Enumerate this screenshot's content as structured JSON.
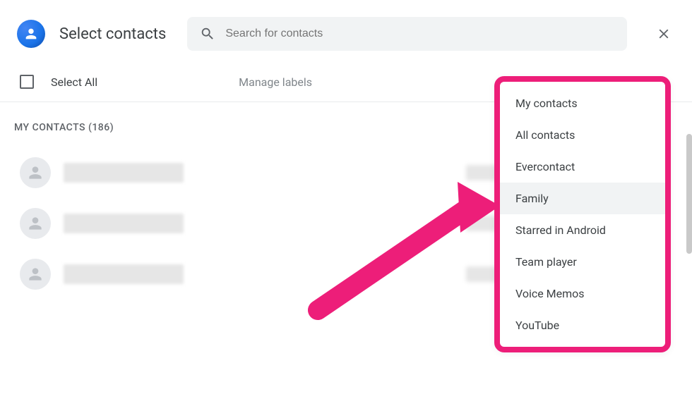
{
  "header": {
    "title": "Select contacts",
    "search_placeholder": "Search for contacts"
  },
  "toolbar": {
    "select_all_label": "Select All",
    "manage_labels_label": "Manage labels"
  },
  "section": {
    "header": "MY CONTACTS (186)"
  },
  "dropdown": {
    "items": [
      {
        "label": "My contacts",
        "highlighted": false
      },
      {
        "label": "All contacts",
        "highlighted": false
      },
      {
        "label": "Evercontact",
        "highlighted": false
      },
      {
        "label": "Family",
        "highlighted": true
      },
      {
        "label": "Starred in Android",
        "highlighted": false
      },
      {
        "label": "Team player",
        "highlighted": false
      },
      {
        "label": "Voice Memos",
        "highlighted": false
      },
      {
        "label": "YouTube",
        "highlighted": false
      }
    ]
  },
  "annotation": {
    "arrow_color": "#ed1e79"
  }
}
